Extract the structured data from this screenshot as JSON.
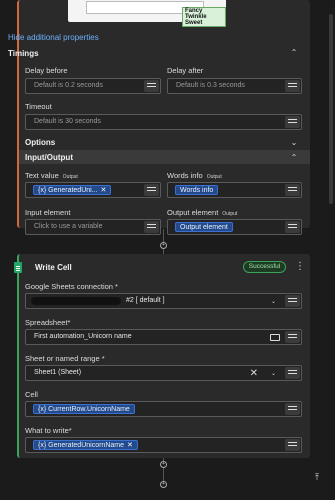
{
  "preview": {
    "text": "Fancy Twinkle Sweet"
  },
  "link": {
    "hide_additional": "Hide additional properties"
  },
  "sections": {
    "timings": "Timings",
    "options": "Options",
    "input_output": "Input/Output"
  },
  "fields": {
    "delay_before": {
      "label": "Delay before",
      "placeholder": "Default is 0.2 seconds"
    },
    "delay_after": {
      "label": "Delay after",
      "placeholder": "Default is 0.3 seconds"
    },
    "timeout": {
      "label": "Timeout",
      "placeholder": "Default is 30 seconds"
    },
    "text_value": {
      "label": "Text value",
      "tag": "Output",
      "chip": "{x} GeneratedUni...",
      "chip_close": "✕"
    },
    "words_info": {
      "label": "Words info",
      "tag": "Output",
      "chip": "Words info"
    },
    "input_element": {
      "label": "Input element",
      "placeholder": "Click to use a variable"
    },
    "output_element": {
      "label": "Output element",
      "tag": "Output",
      "chip": "Output element"
    }
  },
  "write_cell": {
    "title": "Write Cell",
    "status": "Successful",
    "connection": {
      "label": "Google Sheets connection *",
      "value": "#2 [ default ]"
    },
    "spreadsheet": {
      "label": "Spreadsheet*",
      "value": "First automation_Unicorn name"
    },
    "sheet": {
      "label": "Sheet or named range *",
      "value": "Sheet1 (Sheet)"
    },
    "cell": {
      "label": "Cell",
      "chip": "{x} CurrentRow.UnicornName"
    },
    "what_to_write": {
      "label": "What to write*",
      "chip": "{x} GeneratedUnicornName",
      "chip_close": "✕"
    }
  },
  "icons": {
    "chevron_up": "⌃",
    "chevron_down": "⌄",
    "connector": "+",
    "kebab": "⋮",
    "scroll_to_top": "⤒"
  }
}
